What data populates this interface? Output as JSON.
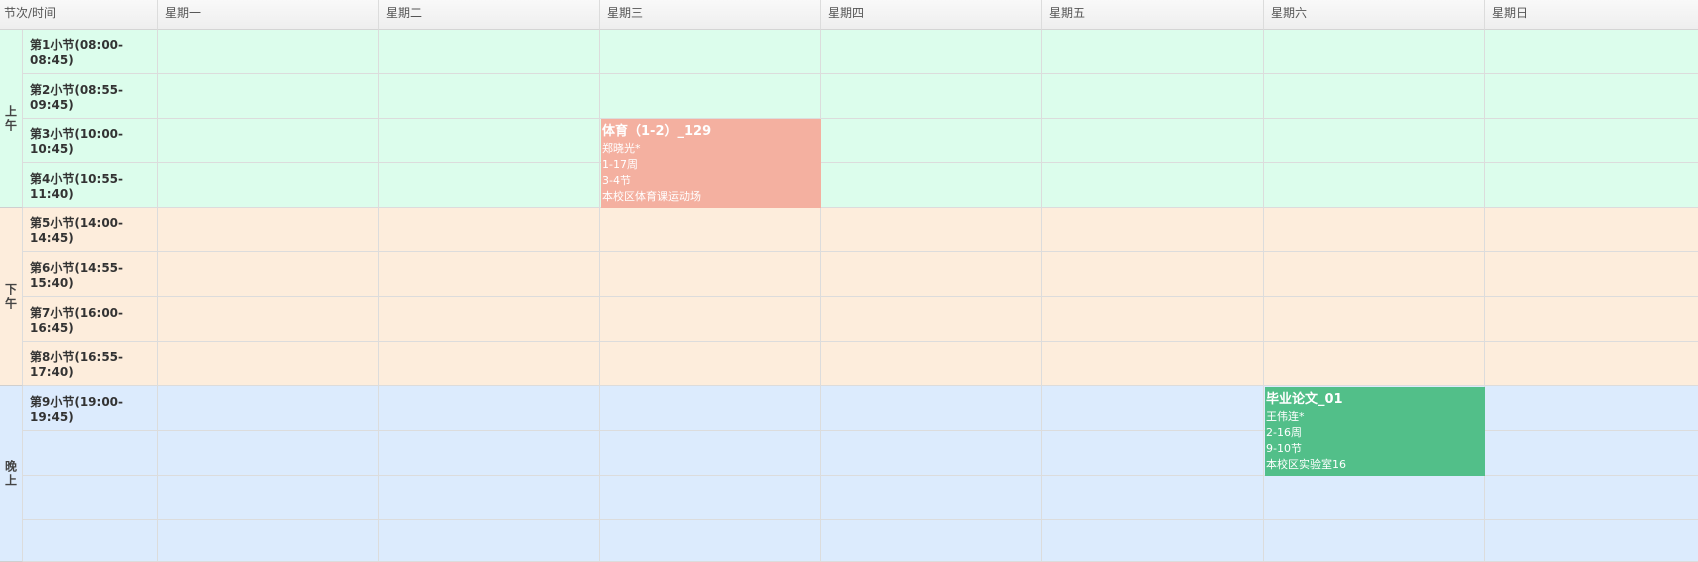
{
  "header": {
    "corner": "节次/时间",
    "days": [
      "星期一",
      "星期二",
      "星期三",
      "星期四",
      "星期五",
      "星期六",
      "星期日"
    ]
  },
  "periods": [
    {
      "label": "上午",
      "slots": [
        "第1小节(08:00-08:45)",
        "第2小节(08:55-09:45)",
        "第3小节(10:00-10:45)",
        "第4小节(10:55-11:40)"
      ]
    },
    {
      "label": "下午",
      "slots": [
        "第5小节(14:00-14:45)",
        "第6小节(14:55-15:40)",
        "第7小节(16:00-16:45)",
        "第8小节(16:55-17:40)"
      ]
    },
    {
      "label": "晚上",
      "slots": [
        "第9小节(19:00-19:45)",
        "",
        "",
        ""
      ]
    }
  ],
  "courses": [
    {
      "name": "体育（1-2）_129",
      "teacher": "郑晓光*",
      "weeks": "1-17周",
      "sections": "3-4节",
      "location": "本校区体育课运动场",
      "color": "#f4b0a0"
    },
    {
      "name": "毕业论文_01",
      "teacher": "王伟连*",
      "weeks": "2-16周",
      "sections": "9-10节",
      "location": "本校区实验室16",
      "color": "#52bf89"
    }
  ],
  "colors": {
    "morning": "#dcfdec",
    "afternoon": "#fdeddc",
    "evening": "#dcebfd"
  }
}
